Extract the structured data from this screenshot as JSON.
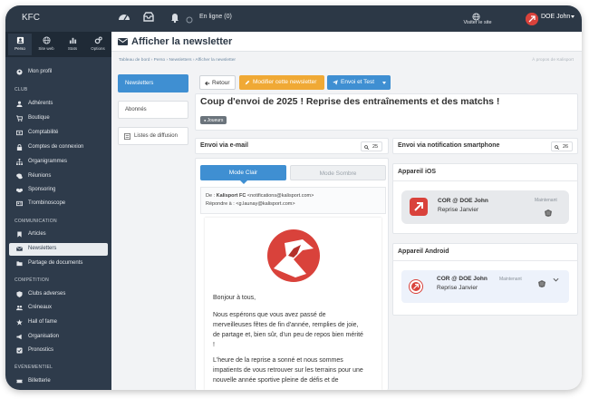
{
  "topbar": {
    "brand": "KFC",
    "online": "En ligne (0)",
    "visiter": "Visiter le site",
    "user": "DOE John"
  },
  "sidebar": {
    "tabs": [
      {
        "label": "Perso"
      },
      {
        "label": "Site web"
      },
      {
        "label": "Stats"
      },
      {
        "label": "Options"
      }
    ],
    "items": [
      {
        "label": "Mon profil"
      },
      {
        "label": "Adhérents"
      },
      {
        "label": "Boutique"
      },
      {
        "label": "Comptabilité"
      },
      {
        "label": "Comptes de connexion"
      },
      {
        "label": "Organigrammes"
      },
      {
        "label": "Réunions"
      },
      {
        "label": "Sponsoring"
      },
      {
        "label": "Trombinoscope"
      },
      {
        "label": "Articles"
      },
      {
        "label": "Newsletters"
      },
      {
        "label": "Partage de documents"
      },
      {
        "label": "Clubs adverses"
      },
      {
        "label": "Créneaux"
      },
      {
        "label": "Hall of fame"
      },
      {
        "label": "Organisation"
      },
      {
        "label": "Pronostics"
      },
      {
        "label": "Billetterie"
      }
    ],
    "sections": [
      "CLUB",
      "COMMUNICATION",
      "COMPÉTITION",
      "ÉVÉNEMENTIEL"
    ]
  },
  "page": {
    "title": "Afficher la newsletter",
    "breadcrumb": "Tableau de bord  ›  Perso  ›  Newsletters  ›  Afficher la newsletter",
    "breadcrumb_right": "À propos de Kalisport"
  },
  "leftnav": {
    "newsletters": "Newsletters",
    "abonnes": "Abonnés",
    "listes": "Listes de diffusion"
  },
  "toolbar": {
    "retour": "Retour",
    "modifier": "Modifier cette newsletter",
    "envoi": "Envoi et Test"
  },
  "newsletter": {
    "subject": "Coup d'envoi de 2025 ! Reprise des entraînements et des matchs !",
    "tag": "Joueurs"
  },
  "email": {
    "header": "Envoi via e-mail",
    "count": "25",
    "tab_clair": "Mode Clair",
    "tab_sombre": "Mode Sombre",
    "de_label": "De :",
    "de_value": "Kalisport FC",
    "de_addr": "<notifications@kalisport.com>",
    "rep_label": "Répondre à :",
    "rep_addr": "<g.launay@kalisport.com>",
    "greeting": "Bonjour à tous,",
    "p1": "Nous espérons que vous avez passé de merveilleuses fêtes de fin d'année, remplies de joie, de partage et, bien sûr, d'un peu de repos bien mérité !",
    "p2": "L'heure de la reprise a sonné et nous sommes impatients de vous retrouver sur les terrains pour une nouvelle année sportive pleine de défis et de"
  },
  "push": {
    "header": "Envoi via notification smartphone",
    "count": "26",
    "ios_title": "Appareil iOS",
    "android_title": "Appareil Android",
    "notif_title": "COR @ DOE John",
    "notif_sub": "Reprise Janvier",
    "time": "Maintenant"
  },
  "colors": {
    "sidebar": "#2e3b4b",
    "topbar": "#2c3846",
    "primary": "#3f8fd2",
    "warning": "#f0a935",
    "logo_red": "#d9423b"
  }
}
